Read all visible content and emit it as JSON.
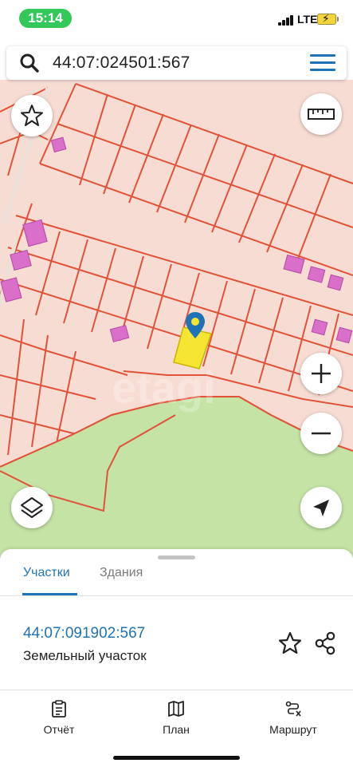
{
  "status_bar": {
    "time": "15:14",
    "network": "LTE",
    "icons": [
      "signal-icon",
      "battery-charging-icon"
    ],
    "colors": {
      "time_pill": "#34c759",
      "battery": "#f5d33a"
    }
  },
  "search": {
    "query": "44:07:024501:567",
    "icons": [
      "search-icon",
      "menu-icon"
    ]
  },
  "map": {
    "icons": [
      "favorite-star-icon",
      "ruler-icon",
      "zoom-in-icon",
      "zoom-out-icon",
      "layers-icon",
      "locate-me-icon",
      "map-pin-icon"
    ],
    "watermark": "etagi",
    "colors": {
      "land": "#f7dcd3",
      "parcel_border": "#e2523a",
      "building": "#d96fc8",
      "green_zone": "#c4e3a4",
      "selected_parcel": "#f5e532",
      "pin": "#1e73b6"
    }
  },
  "sheet": {
    "tabs": [
      {
        "label": "Участки",
        "active": true
      },
      {
        "label": "Здания",
        "active": false
      }
    ],
    "parcel_id": "44:07:091902:567",
    "parcel_type": "Земельный участок",
    "icons": [
      "star-outline-icon",
      "share-icon"
    ]
  },
  "nav": {
    "items": [
      {
        "label": "Отчёт",
        "icon": "report-icon"
      },
      {
        "label": "План",
        "icon": "map-plan-icon"
      },
      {
        "label": "Маршрут",
        "icon": "route-icon"
      }
    ]
  },
  "colors": {
    "accent": "#1e73b6"
  }
}
